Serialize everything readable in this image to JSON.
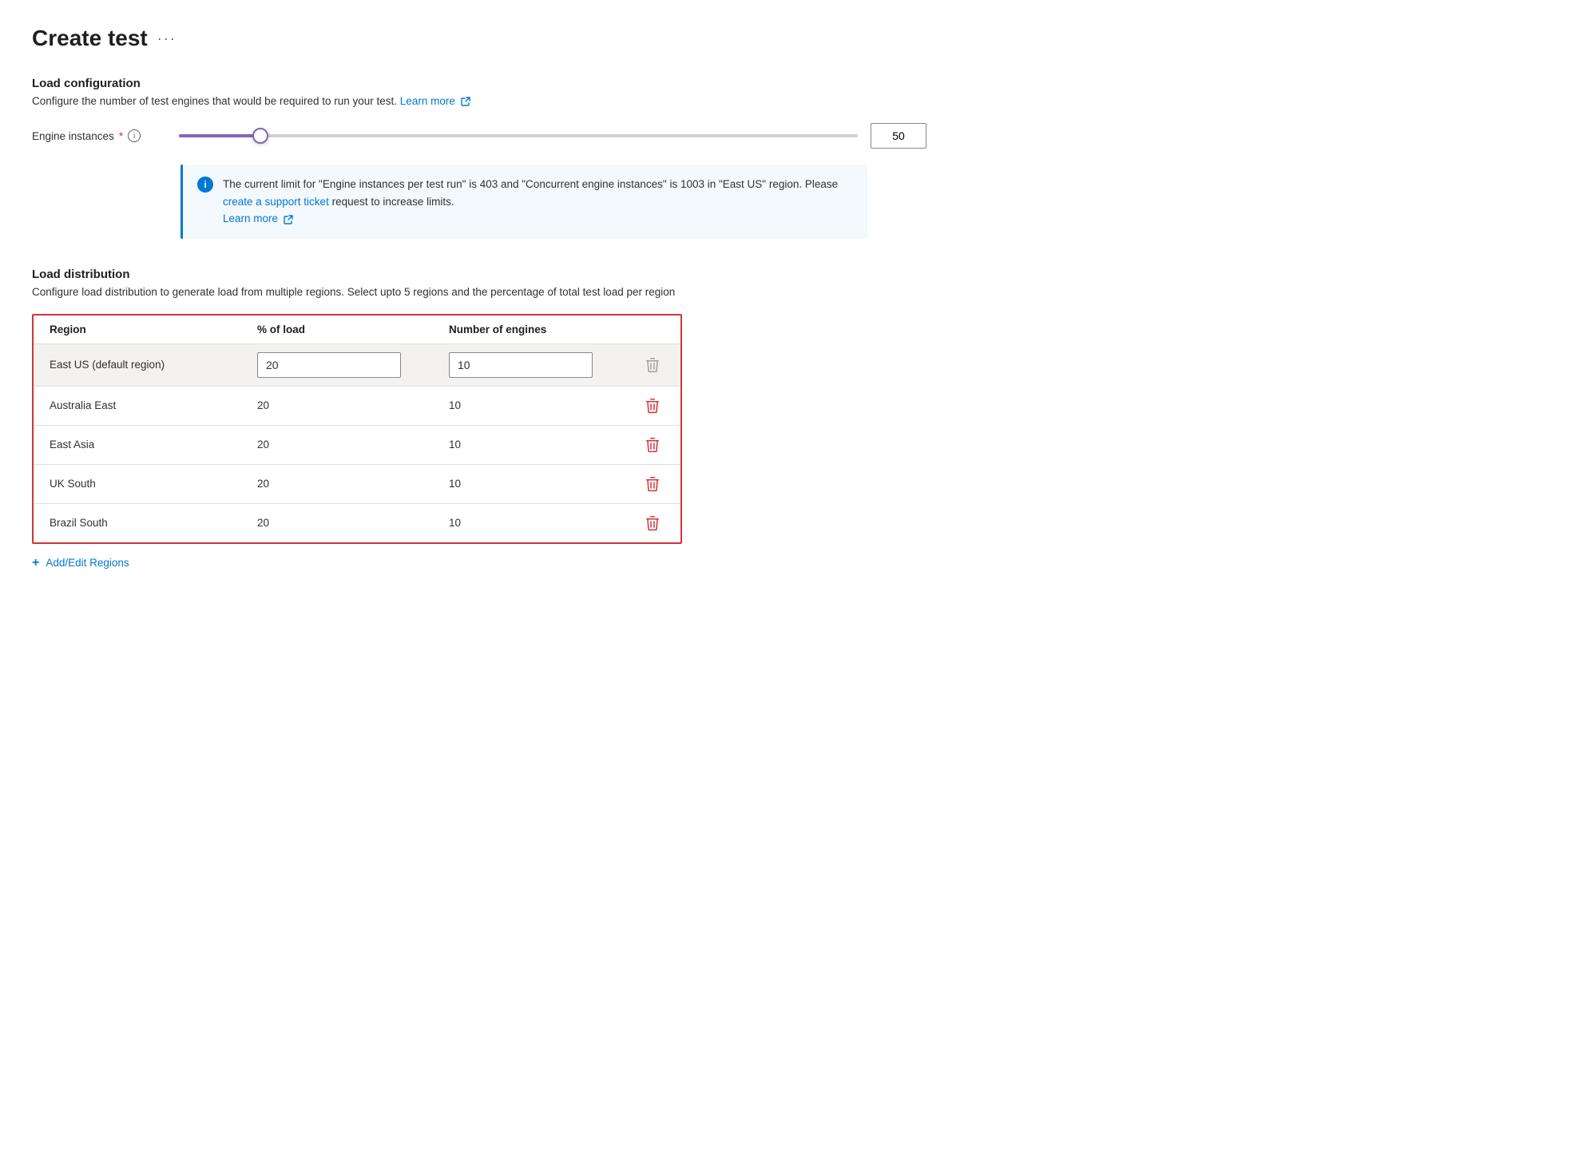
{
  "page": {
    "title": "Create test",
    "title_ellipsis": "···"
  },
  "load_configuration": {
    "section_title": "Load configuration",
    "description": "Configure the number of test engines that would be required to run your test.",
    "learn_more_label": "Learn more",
    "engine_instances_label": "Engine instances",
    "engine_instances_value": "50",
    "info_message": "The current limit for \"Engine instances per test run\" is 403 and \"Concurrent engine instances\" is 1003 in \"East US\" region. Please",
    "support_ticket_link": "create a support ticket",
    "info_message_end": "request to increase limits.",
    "info_learn_more": "Learn more"
  },
  "load_distribution": {
    "section_title": "Load distribution",
    "description": "Configure load distribution to generate load from multiple regions. Select upto 5 regions and the percentage of total test load per region",
    "col_region": "Region",
    "col_load": "% of load",
    "col_engines": "Number of engines",
    "regions": [
      {
        "name": "East US (default region)",
        "load": "20",
        "engines": "10",
        "active": true,
        "deletable": false
      },
      {
        "name": "Australia East",
        "load": "20",
        "engines": "10",
        "active": false,
        "deletable": true
      },
      {
        "name": "East Asia",
        "load": "20",
        "engines": "10",
        "active": false,
        "deletable": true
      },
      {
        "name": "UK South",
        "load": "20",
        "engines": "10",
        "active": false,
        "deletable": true
      },
      {
        "name": "Brazil South",
        "load": "20",
        "engines": "10",
        "active": false,
        "deletable": true
      }
    ],
    "add_regions_label": "Add/Edit Regions"
  }
}
